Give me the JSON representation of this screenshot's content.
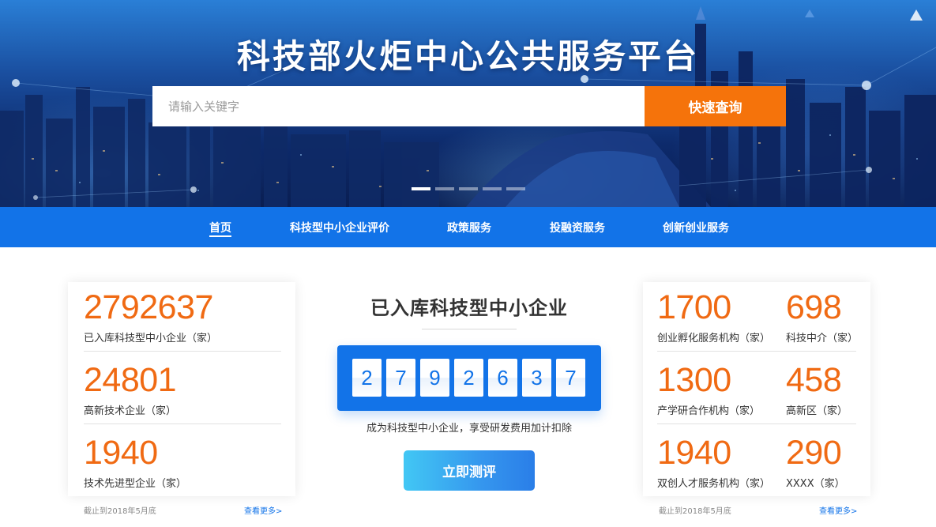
{
  "hero": {
    "title": "科技部火炬中心公共服务平台",
    "search_placeholder": "请输入关键字",
    "search_button": "快速查询",
    "carousel_count": 5,
    "carousel_active_index": 0
  },
  "nav": {
    "items": [
      {
        "label": "首页",
        "active": true
      },
      {
        "label": "科技型中小企业评价",
        "active": false
      },
      {
        "label": "政策服务",
        "active": false
      },
      {
        "label": "投融资服务",
        "active": false
      },
      {
        "label": "创新创业服务",
        "active": false
      }
    ]
  },
  "left_card": {
    "stats": [
      {
        "value": "2792637",
        "label": "已入库科技型中小企业（家）"
      },
      {
        "value": "24801",
        "label": "高新技术企业（家）"
      },
      {
        "value": "1940",
        "label": "技术先进型企业（家）"
      }
    ],
    "footnote": "截止到2018年5月底",
    "more_link": "查看更多>"
  },
  "center": {
    "title": "已入库科技型中小企业",
    "digits": [
      "2",
      "7",
      "9",
      "2",
      "6",
      "3",
      "7"
    ],
    "subtitle": "成为科技型中小企业，享受研发费用加计扣除",
    "button": "立即测评"
  },
  "right_card": {
    "stats": [
      {
        "value": "1700",
        "label": "创业孵化服务机构（家）"
      },
      {
        "value": "698",
        "label": "科技中介（家）"
      },
      {
        "value": "1300",
        "label": "产学研合作机构（家）"
      },
      {
        "value": "458",
        "label": "高新区（家）"
      },
      {
        "value": "1940",
        "label": "双创人才服务机构（家）"
      },
      {
        "value": "290",
        "label": "XXXX（家）"
      }
    ],
    "footnote": "截止到2018年5月底",
    "more_link": "查看更多>"
  },
  "colors": {
    "nav_blue": "#1273e8",
    "accent_orange": "#f06a13",
    "search_button": "#f5730b"
  }
}
